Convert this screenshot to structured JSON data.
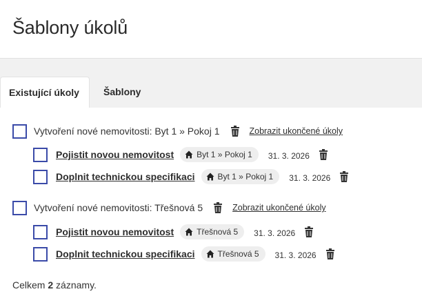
{
  "page": {
    "title": "Šablony úkolů"
  },
  "tabs": [
    {
      "label": "Existující úkoly",
      "active": true
    },
    {
      "label": "Šablony",
      "active": false
    }
  ],
  "groups": [
    {
      "label": "Vytvoření nové nemovitosti: Byt 1 » Pokoj 1",
      "show_completed": "Zobrazit ukončené úkoly",
      "tasks": [
        {
          "title": "Pojistit novou nemovitost",
          "chip": "Byt 1 » Pokoj 1",
          "date": "31. 3. 2026"
        },
        {
          "title": "Doplnit technickou specifikaci",
          "chip": "Byt 1 » Pokoj 1",
          "date": "31. 3. 2026"
        }
      ]
    },
    {
      "label": "Vytvoření nové nemovitosti: Třešnová 5",
      "show_completed": "Zobrazit ukončené úkoly",
      "tasks": [
        {
          "title": "Pojistit novou nemovitost",
          "chip": "Třešnová 5",
          "date": "31. 3. 2026"
        },
        {
          "title": "Doplnit technickou specifikaci",
          "chip": "Třešnová 5",
          "date": "31. 3. 2026"
        }
      ]
    }
  ],
  "footer": {
    "prefix": "Celkem",
    "count": "2",
    "suffix": "záznamy."
  },
  "icons": {
    "trash": "trash-icon",
    "home": "home-icon"
  },
  "colors": {
    "checkbox_border": "#3a4aa8",
    "tabbar_bg": "#f1f1f1",
    "chip_bg": "#eeeeee"
  }
}
